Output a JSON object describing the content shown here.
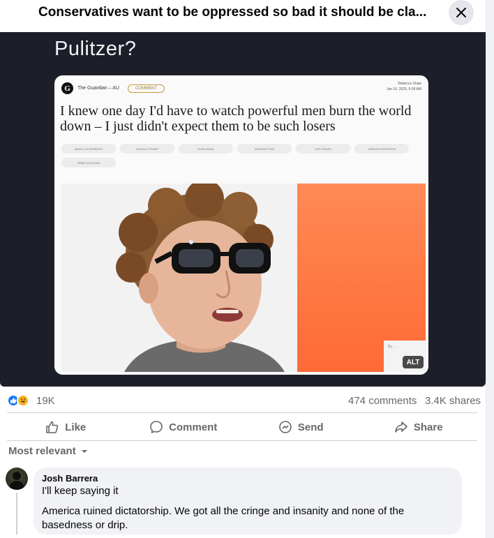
{
  "post": {
    "title": "Conservatives want to be oppressed so bad it should be cla..."
  },
  "media": {
    "question_ghost": "Pulitzer?",
    "question": "Pulitzer?",
    "article": {
      "publication": "The Guardian – AU",
      "category": "COMMENT",
      "byline_name": "Rebecca Shaw",
      "byline_date": "Jan 16, 2025, 6:00 AM",
      "headline": "I knew one day I'd have to watch powerful men burn the world down – I just didn't expect them to be such losers",
      "tags": [
        "MARK ZUCKERBERG",
        "DONALD TRUMP",
        "ELON MUSK",
        "ANDREW TATE",
        "JOE ROGAN",
        "JORDAN PETERSON",
        "REBECCA SHAW"
      ],
      "caption": "By ..."
    },
    "alt_label": "ALT"
  },
  "stats": {
    "reactions_count": "19K",
    "comments": "474 comments",
    "shares": "3.4K shares"
  },
  "actions": {
    "like": "Like",
    "comment": "Comment",
    "send": "Send",
    "share": "Share"
  },
  "sort": {
    "label": "Most relevant"
  },
  "comments": [
    {
      "author": "Josh Barrera",
      "line1": "I'll keep saying it",
      "line2": "America ruined dictatorship. We got all the cringe and insanity and none of the basedness or drip."
    }
  ],
  "colors": {
    "accent": "#1877f2",
    "media_bg": "#1c1f2a",
    "muted_text": "#65676b",
    "orange": "#ff7a45"
  },
  "icons": [
    "close-icon",
    "like-reaction-icon",
    "haha-reaction-icon",
    "thumbs-up-icon",
    "comment-icon",
    "send-icon",
    "share-icon",
    "chevron-down-icon"
  ]
}
